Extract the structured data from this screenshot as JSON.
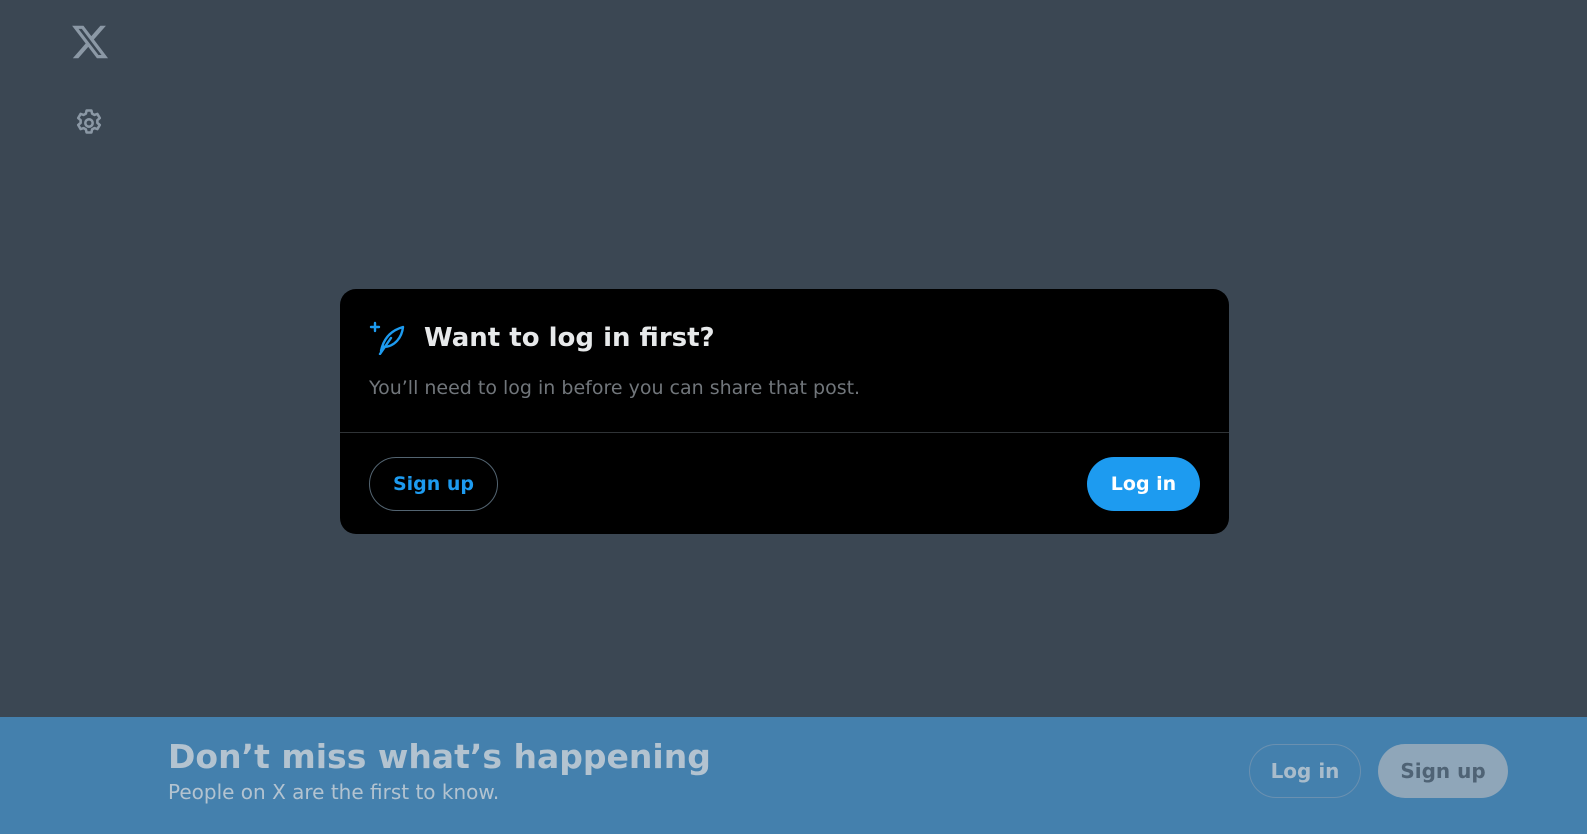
{
  "sidebar": {
    "logo_icon": "x-logo-icon",
    "settings_icon": "gear-icon"
  },
  "modal": {
    "icon": "feather-plus-icon",
    "title": "Want to log in first?",
    "text": "You’ll need to log in before you can share that post.",
    "signup_label": "Sign up",
    "login_label": "Log in"
  },
  "banner": {
    "title": "Don’t miss what’s happening",
    "subtitle": "People on X are the first to know.",
    "login_label": "Log in",
    "signup_label": "Sign up"
  },
  "colors": {
    "accent": "#1d9bf0",
    "overlay": "#3b4753",
    "banner": "#4480ad"
  }
}
